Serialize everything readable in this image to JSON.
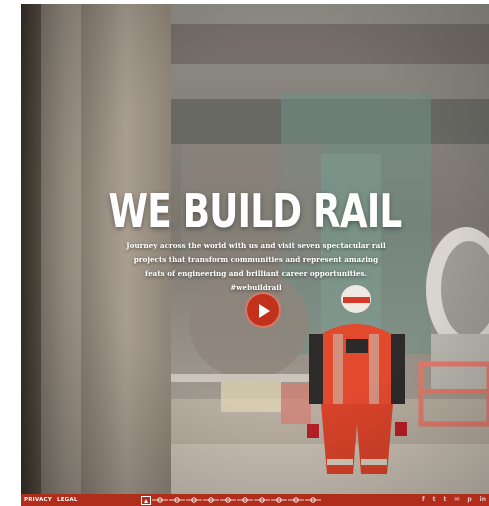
{
  "hero": {
    "title": "WE BUILD RAIL",
    "description": "Journey across the world with us and visit seven spectacular rail projects that transform communities and represent amazing feats of engineering and brilliant career opportunities. #webuildrail"
  },
  "footer": {
    "privacy_label": "PRIVACY",
    "legal_label": "LEGAL",
    "nav_dots": [
      "home-icon",
      "dot",
      "dot",
      "dot",
      "dot",
      "dot",
      "dot",
      "dot",
      "dot",
      "dot",
      "dot"
    ],
    "social": [
      {
        "name": "facebook-icon",
        "glyph": "f"
      },
      {
        "name": "twitter-icon",
        "glyph": "t"
      },
      {
        "name": "tumblr-icon",
        "glyph": "t"
      },
      {
        "name": "email-icon",
        "glyph": "✉"
      },
      {
        "name": "pinterest-icon",
        "glyph": "p"
      },
      {
        "name": "linkedin-icon",
        "glyph": "in"
      }
    ]
  },
  "colors": {
    "accent": "#b02d1b",
    "play_button": "#c2311c"
  }
}
